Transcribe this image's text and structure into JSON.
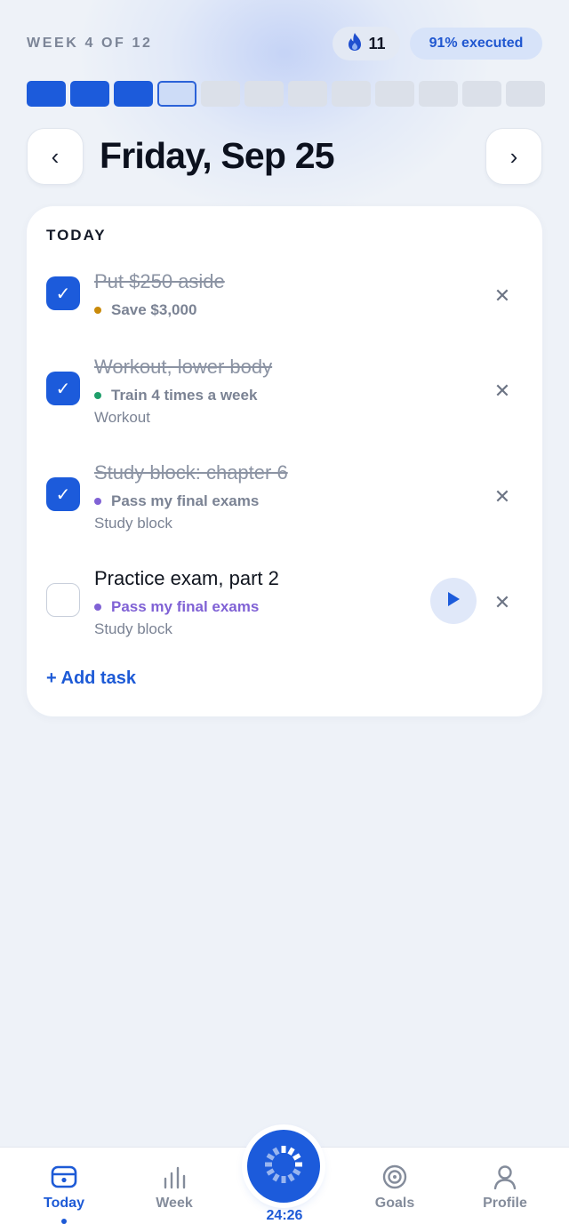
{
  "header": {
    "week_label": "WEEK 4 OF 12",
    "streak_count": "11",
    "streak_icon": "flame-icon",
    "executed_label": "91% executed"
  },
  "progress": {
    "total_weeks": 12,
    "completed_weeks": 3,
    "current_week": 4
  },
  "day_nav": {
    "title": "Friday, Sep 25",
    "prev_icon": "‹",
    "next_icon": "›"
  },
  "today": {
    "section_title": "TODAY",
    "tasks": [
      {
        "title": "Put $250 aside",
        "goal": "Save $3,000",
        "goal_color": "#c98a0a",
        "subtitle": "",
        "done": true
      },
      {
        "title": "Workout, lower body",
        "goal": "Train 4 times a week",
        "goal_color": "#1e9e6a",
        "subtitle": "Workout",
        "done": true
      },
      {
        "title": "Study block: chapter 6",
        "goal": "Pass my final exams",
        "goal_color": "#8062d5",
        "subtitle": "Study block",
        "done": true
      },
      {
        "title": "Practice exam, part 2",
        "goal": "Pass my final exams",
        "goal_color": "#8062d5",
        "subtitle": "Study block",
        "done": false
      }
    ],
    "check_mark": "✓",
    "remove_mark": "✕",
    "add_task_label": "+ Add task"
  },
  "tabbar": {
    "today": "Today",
    "week": "Week",
    "timer": "24:26",
    "goals": "Goals",
    "profile": "Profile"
  },
  "colors": {
    "accent": "#1c5bdb",
    "goal_money": "#c98a0a",
    "goal_fitness": "#1e9e6a",
    "goal_study": "#8062d5"
  }
}
